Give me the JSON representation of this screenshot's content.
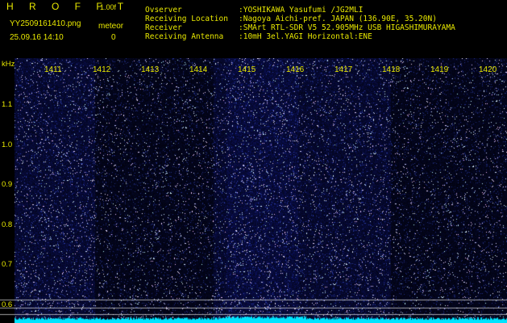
{
  "header": {
    "title": "H R O F F T",
    "version": "1.00f",
    "filename": "YY2509161410.png",
    "datetime": "25.09.16 14:10",
    "meteor_label": "meteor",
    "meteor_count": "0"
  },
  "info": [
    {
      "key": "Ovserver",
      "value": ":YOSHIKAWA Yasufumi /JG2MLI"
    },
    {
      "key": "Receiving Location",
      "value": ":Nagoya Aichi-pref. JAPAN (136.90E, 35.20N)"
    },
    {
      "key": "Receiver",
      "value": ":SMArt RTL-SDR V5 52.905MHz USB HIGASHIMURAYAMA"
    },
    {
      "key": "Receiving Antenna",
      "value": ":10mH 3el.YAGI Horizontal:ENE"
    }
  ],
  "axis": {
    "y_unit": "kHz",
    "y_ticks": [
      "1.1",
      "1.0",
      "0.9",
      "0.8",
      "0.7",
      "0.6"
    ],
    "x_ticks": [
      "1411",
      "1412",
      "1413",
      "1414",
      "1415",
      "1416",
      "1417",
      "1418",
      "1419",
      "1420"
    ]
  },
  "colors": {
    "text": "#e8e800",
    "background": "#000000",
    "spectrum": "#1a2acc",
    "baseline": "#00e8ff"
  }
}
